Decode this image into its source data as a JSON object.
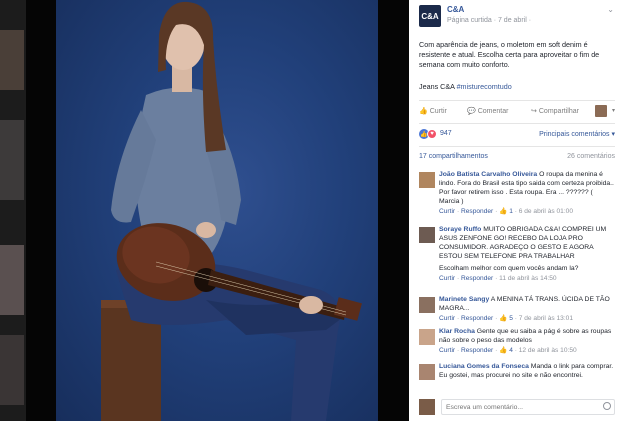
{
  "post": {
    "page_name": "C&A",
    "logo_text": "C&A",
    "meta": "Página curtida · 7 de abril ·",
    "text": "Com aparência de jeans, o moletom em soft denim é resistente e atual. Escolha certa para aproveitar o fim de semana com muito conforto.",
    "hashtags_prefix": "Jeans C&A ",
    "hashtags_tag": "#misturecomtudo"
  },
  "actions": {
    "like": "Curtir",
    "comment": "Comentar",
    "share": "Compartilhar"
  },
  "reactions": {
    "count": "947",
    "top_comments": "Principais comentários ▾"
  },
  "stats": {
    "shares": "17 compartilhamentos",
    "comments": "26 comentários"
  },
  "comments": [
    {
      "name": "João Batista Carvalho Oliveira",
      "text": " O roupa da menina é lindo. Fora do Brasil esta tipo saida com certeza proibida.. Por favor retirem isso . Esta roupa. Era ... ?????? ( Marcia )",
      "like": "Curtir",
      "reply": "Responder",
      "likes": "1",
      "time": "6 de abril às 01:00"
    },
    {
      "name": "Soraye Ruffo",
      "text": " MUITO OBRIGADA C&A! COMPREI UM ASUS ZENFONE GO! RECEBO DA LOJA PRO CONSUMIDOR. AGRADEÇO O GESTO E AGORA ESTOU SEM TELEFONE PRA TRABALHAR",
      "extra": "Escolham melhor com quem vocês andam la?",
      "like": "Curtir",
      "reply": "Responder",
      "time": "11 de abril às 14:50"
    },
    {
      "name": "Marinete Sangy",
      "text": " A MENINA TÁ TRANS. ÚCIDA DE TÃO MAGRA...",
      "like": "Curtir",
      "reply": "Responder",
      "likes": "5",
      "time": "7 de abril às 13:01"
    },
    {
      "name": "Klar Rocha",
      "text": " Gente que eu saiba a pág é sobre as roupas não sobre o peso das modelos",
      "like": "Curtir",
      "reply": "Responder",
      "likes": "4",
      "time": "12 de abril às 10:50"
    },
    {
      "name": "Luciana Gomes da Fonseca",
      "text": " Manda o link para comprar. Eu gostei, mas procurei no site e não encontrei.",
      "like": "",
      "reply": "",
      "time": ""
    }
  ],
  "composer": {
    "placeholder": "Escreva um comentário..."
  },
  "colors": {
    "link": "#365899",
    "background_blue": "#21407a",
    "text": "#1d2129",
    "meta": "#90949c"
  }
}
